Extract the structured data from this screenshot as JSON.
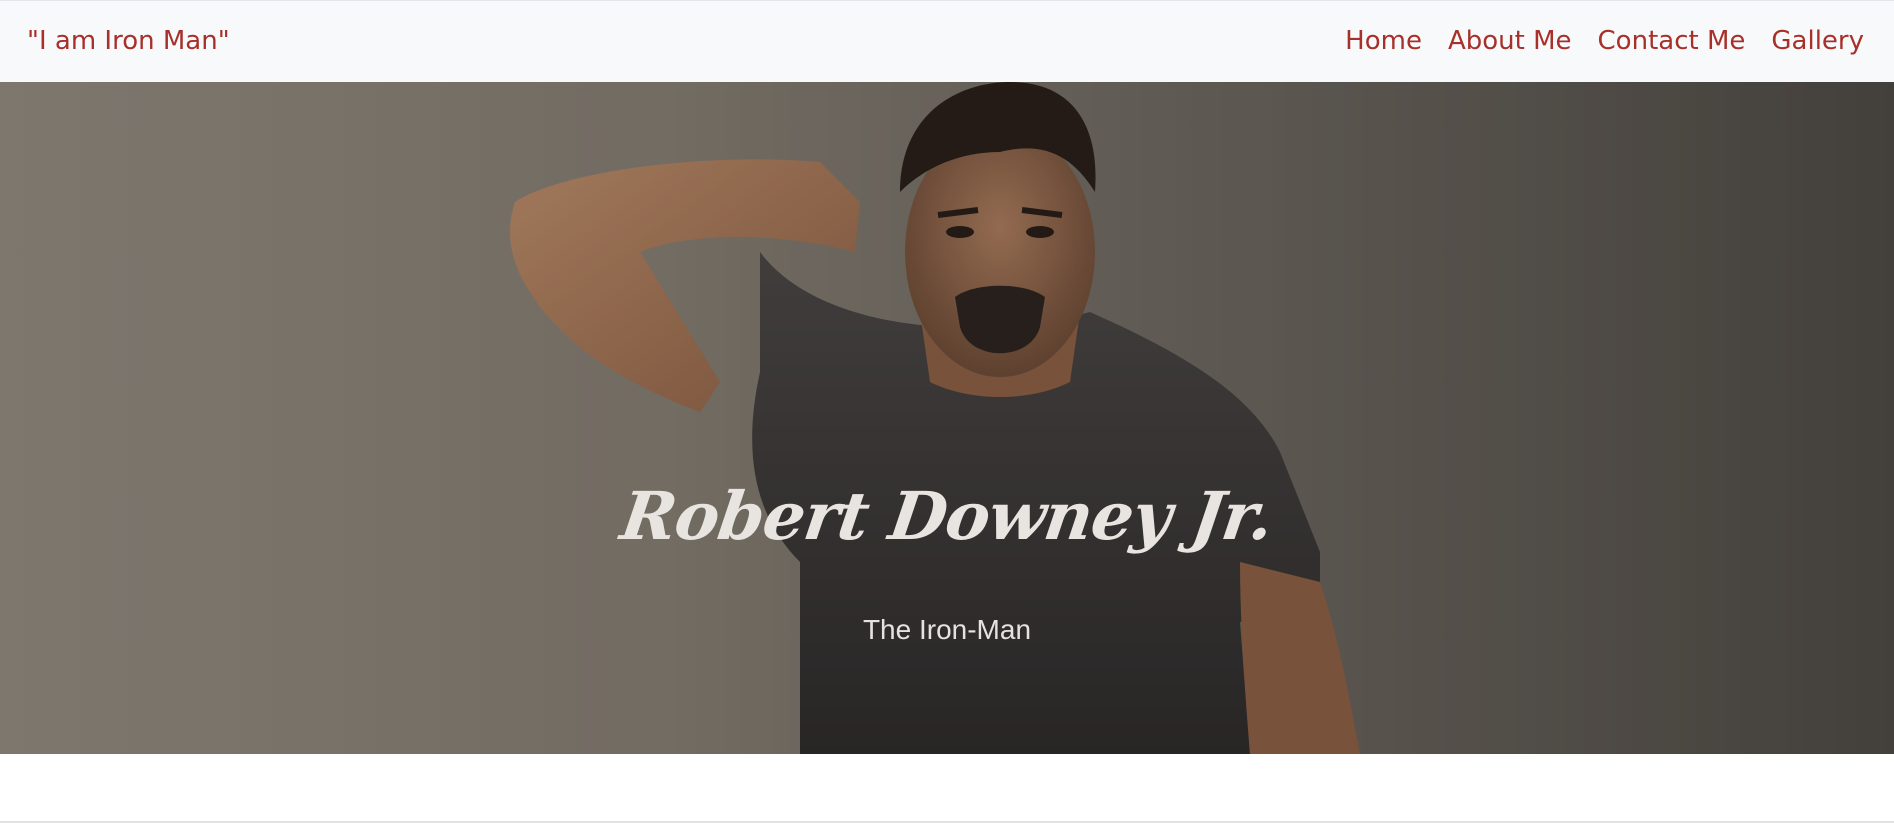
{
  "navbar": {
    "brand": "\"I am Iron Man\"",
    "links": [
      "Home",
      "About Me",
      "Contact Me",
      "Gallery"
    ]
  },
  "hero": {
    "title": "Robert Downey Jr.",
    "subtitle": "The Iron-Man"
  },
  "colors": {
    "accent": "#a8302a",
    "navbar_bg": "#f8f9fb",
    "hero_text": "#e8e4e0"
  },
  "icons": {
    "hero_image": "portrait-photo"
  }
}
